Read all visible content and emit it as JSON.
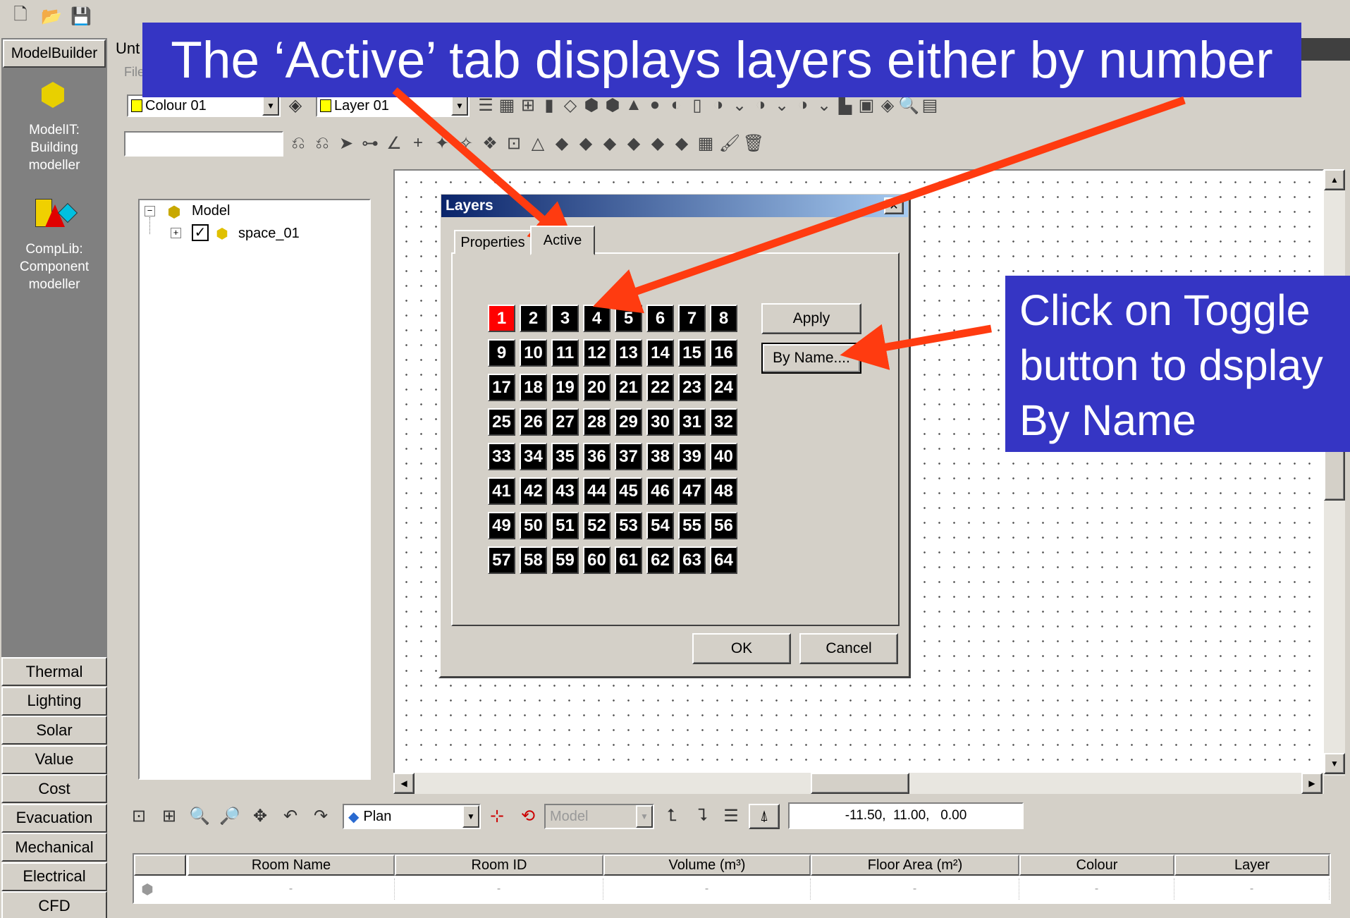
{
  "window": {
    "title_fragment": "Unt",
    "menu_fragment": "File"
  },
  "toolbar": {
    "colour_value": "Colour 01",
    "layer_value": "Layer 01",
    "command_input": ""
  },
  "sidebar": {
    "header": "ModelBuilder",
    "apps": [
      {
        "label": "ModelIT:\nBuilding\nmodeller",
        "icon": "modelit-icon"
      },
      {
        "label": "CompLib:\nComponent\nmodeller",
        "icon": "complib-icon"
      }
    ],
    "nav": [
      "Thermal",
      "Lighting",
      "Solar",
      "Value",
      "Cost",
      "Evacuation",
      "Mechanical",
      "Electrical",
      "CFD"
    ]
  },
  "tree": {
    "root": "Model",
    "child": "space_01"
  },
  "dialog": {
    "title": "Layers",
    "tabs": [
      "Properties",
      "Active"
    ],
    "active_tab": "Active",
    "layers": [
      1,
      2,
      3,
      4,
      5,
      6,
      7,
      8,
      9,
      10,
      11,
      12,
      13,
      14,
      15,
      16,
      17,
      18,
      19,
      20,
      21,
      22,
      23,
      24,
      25,
      26,
      27,
      28,
      29,
      30,
      31,
      32,
      33,
      34,
      35,
      36,
      37,
      38,
      39,
      40,
      41,
      42,
      43,
      44,
      45,
      46,
      47,
      48,
      49,
      50,
      51,
      52,
      53,
      54,
      55,
      56,
      57,
      58,
      59,
      60,
      61,
      62,
      63,
      64
    ],
    "active_layer": 1,
    "apply": "Apply",
    "by_name": "By Name....",
    "ok": "OK",
    "cancel": "Cancel"
  },
  "bottom_toolbar": {
    "view": "Plan",
    "model": "Model",
    "coords": "-11.50,  11.00,   0.00"
  },
  "table": {
    "columns": [
      "Room Name",
      "Room ID",
      "Volume (m³)",
      "Floor Area (m²)",
      "Colour",
      "Layer"
    ],
    "row": [
      "-",
      "-",
      "-",
      "-",
      "-",
      "-"
    ]
  },
  "callouts": {
    "top": "The ‘Active’ tab displays layers either by number",
    "right": [
      "Click on Toggle",
      "button to dsplay",
      "By Name"
    ]
  },
  "colors": {
    "callout_bg": "#3535c4",
    "arrow": "#ff3b10",
    "active_layer": "#ff0000"
  }
}
